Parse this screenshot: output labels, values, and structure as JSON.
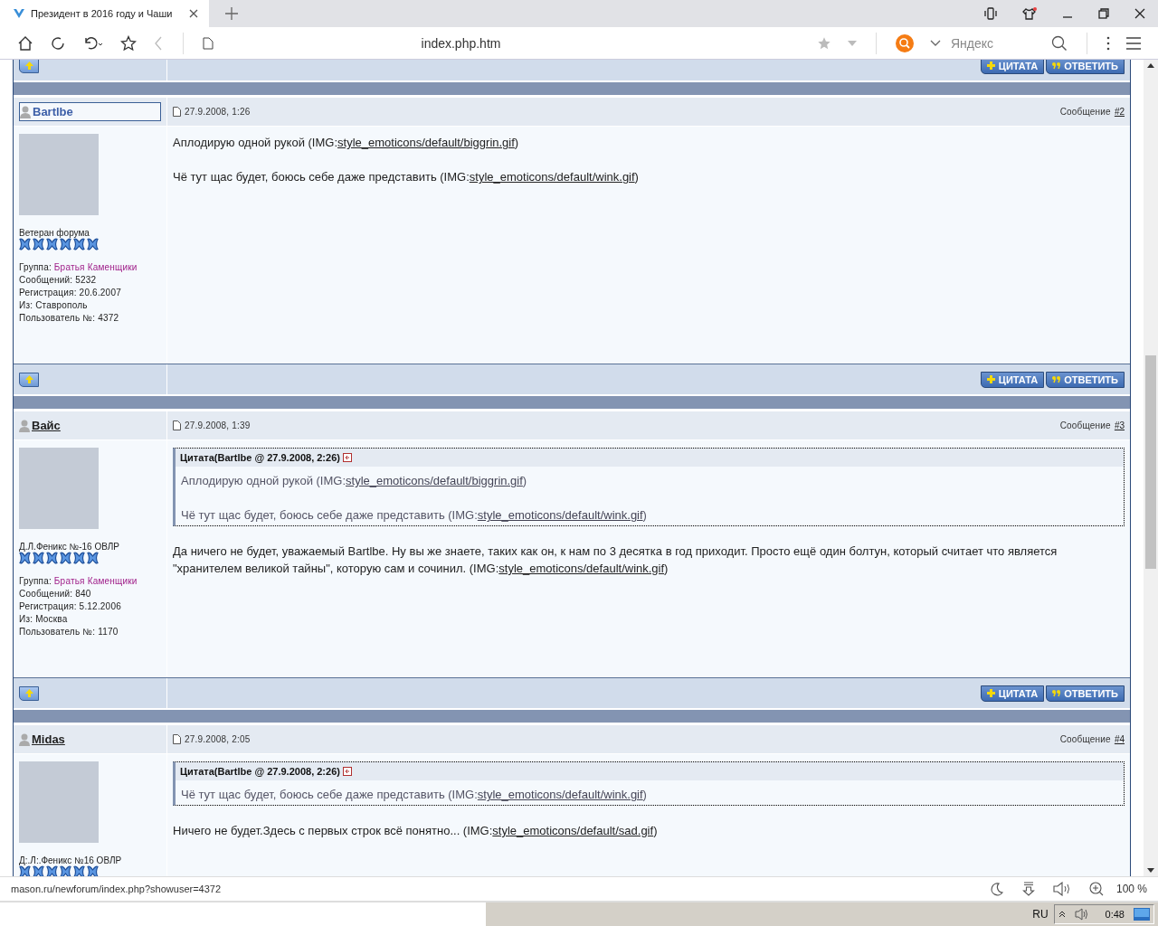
{
  "tab": {
    "title": "Президент в 2016 году и Чаши"
  },
  "address": {
    "url": "index.php.htm"
  },
  "search": {
    "placeholder": "Яндекс"
  },
  "leading_footer": {
    "buttons": [
      {
        "kind": "plus",
        "label": "ЦИТАТА"
      },
      {
        "kind": "quote-mark",
        "label": "ОТВЕТИТЬ"
      }
    ]
  },
  "posts": [
    {
      "author": "Bartlbe",
      "highlighted": true,
      "date": "27.9.2008, 1:26",
      "message_label": "Сообщение",
      "number": "#2",
      "rank": "Ветеран форума",
      "group": {
        "label": "Группа:",
        "value": "Братья Каменщики"
      },
      "info": [
        "Сообщений: 5232",
        "Регистрация: 20.6.2007",
        "Из: Ставрополь",
        "Пользователь №: 4372"
      ],
      "paragraphs": [
        {
          "before": "Аплодирую одной рукой (IMG:",
          "link": "style_emoticons/default/biggrin.gif",
          "after": ")"
        },
        {
          "before": "Чё тут щас будет, боюсь себе даже представить (IMG:",
          "link": "style_emoticons/default/wink.gif",
          "after": ")"
        }
      ],
      "footer_buttons": [
        {
          "kind": "plus",
          "label": "ЦИТАТА"
        },
        {
          "kind": "quote-mark",
          "label": "ОТВЕТИТЬ"
        }
      ]
    },
    {
      "author": "Вайс",
      "highlighted": false,
      "date": "27.9.2008, 1:39",
      "message_label": "Сообщение",
      "number": "#3",
      "rank": "Д.Л.Феникс №-16 ОВЛР",
      "group": {
        "label": "Группа:",
        "value": "Братья Каменщики"
      },
      "info": [
        "Сообщений: 840",
        "Регистрация: 5.12.2006",
        "Из: Москва",
        "Пользователь №: 1170"
      ],
      "quotes": [
        {
          "header": "Цитата(Bartlbe @ 27.9.2008, 2:26)",
          "paragraphs": [
            {
              "before": "Аплодирую одной рукой (IMG:",
              "link": "style_emoticons/default/biggrin.gif",
              "after": ")"
            },
            {
              "before": "Чё тут щас будет, боюсь себе даже представить (IMG:",
              "link": "style_emoticons/default/wink.gif",
              "after": ")"
            }
          ]
        }
      ],
      "paragraphs": [
        {
          "before": "Да ничего не будет, уважаемый Bartlbe. Ну вы же знаете, таких как он, к нам по 3 десятка в год приходит. Просто ещё один болтун, который считает что является \"хранителем великой тайны\", которую сам и сочинил. (IMG:",
          "link": "style_emoticons/default/wink.gif",
          "after": ")"
        }
      ],
      "footer_buttons": [
        {
          "kind": "plus",
          "label": "ЦИТАТА"
        },
        {
          "kind": "quote-mark",
          "label": "ОТВЕТИТЬ"
        }
      ]
    },
    {
      "author": "Midas",
      "highlighted": false,
      "date": "27.9.2008, 2:05",
      "message_label": "Сообщение",
      "number": "#4",
      "rank": "Д:.Л:.Феникс №16 ОВЛР",
      "quotes": [
        {
          "header": "Цитата(Bartlbe @ 27.9.2008, 2:26)",
          "paragraphs": [
            {
              "before": "Чё тут щас будет, боюсь себе даже представить (IMG:",
              "link": "style_emoticons/default/wink.gif",
              "after": ")"
            }
          ]
        }
      ],
      "paragraphs": [
        {
          "before": "Ничего не будет.Здесь с первых строк всё понятно... (IMG:",
          "link": "style_emoticons/default/sad.gif",
          "after": ")"
        }
      ]
    }
  ],
  "status_bar": {
    "url": "mason.ru/newforum/index.php?showuser=4372",
    "zoom": "100 %"
  },
  "taskbar": {
    "language": "RU",
    "time": "0:48"
  }
}
